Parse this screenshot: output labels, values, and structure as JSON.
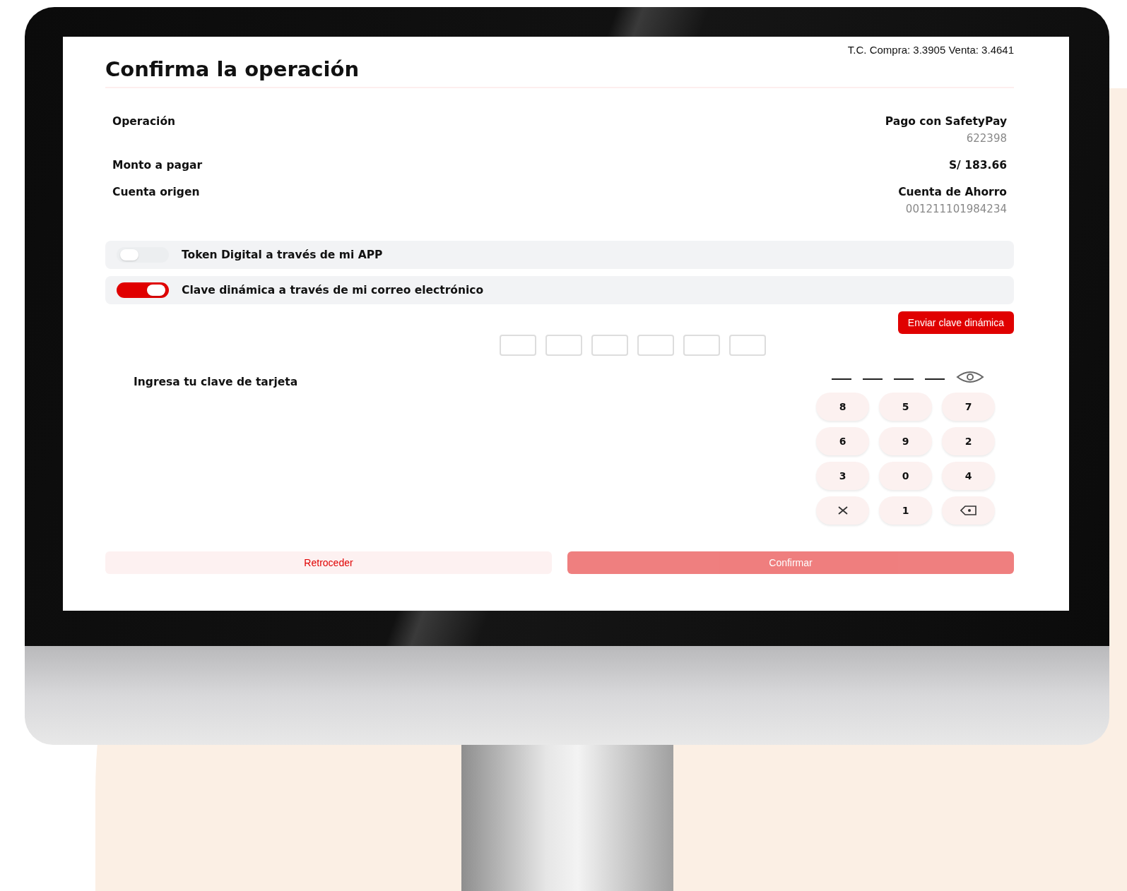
{
  "exchange_rate": "T.C. Compra: 3.3905 Venta: 3.4641",
  "title": "Confirma la operación",
  "details": [
    {
      "label": "Operación",
      "value": "Pago con SafetyPay",
      "sub": "622398"
    },
    {
      "label": "Monto a pagar",
      "value": "S/ 183.66"
    },
    {
      "label": "Cuenta origen",
      "value": "Cuenta de Ahorro",
      "sub": "001211101984234"
    }
  ],
  "auth_options": [
    {
      "label": "Token Digital a través de mi APP",
      "on": false
    },
    {
      "label": "Clave dinámica a través de mi correo electrónico",
      "on": true
    }
  ],
  "send_button": "Enviar clave dinámica",
  "code_boxes": [
    {
      "filled": false
    },
    {
      "filled": false
    },
    {
      "filled": false
    },
    {
      "filled": false
    },
    {
      "filled": false
    },
    {
      "filled": false
    }
  ],
  "card_pin": {
    "label": "Ingresa tu clave de tarjeta",
    "digits": [
      {
        "filled": false
      },
      {
        "filled": false
      },
      {
        "filled": false
      },
      {
        "filled": false
      }
    ]
  },
  "keypad": [
    {
      "kind": "digit",
      "label": "8"
    },
    {
      "kind": "digit",
      "label": "5"
    },
    {
      "kind": "digit",
      "label": "7"
    },
    {
      "kind": "digit",
      "label": "6"
    },
    {
      "kind": "digit",
      "label": "9"
    },
    {
      "kind": "digit",
      "label": "2"
    },
    {
      "kind": "digit",
      "label": "3"
    },
    {
      "kind": "digit",
      "label": "0"
    },
    {
      "kind": "digit",
      "label": "4"
    },
    {
      "kind": "clear"
    },
    {
      "kind": "digit",
      "label": "1"
    },
    {
      "kind": "backspace"
    }
  ],
  "buttons": [
    {
      "label": "Retroceder",
      "kind": "secondary",
      "disabled": false
    },
    {
      "label": "Confirmar",
      "kind": "primary",
      "disabled": true
    }
  ]
}
